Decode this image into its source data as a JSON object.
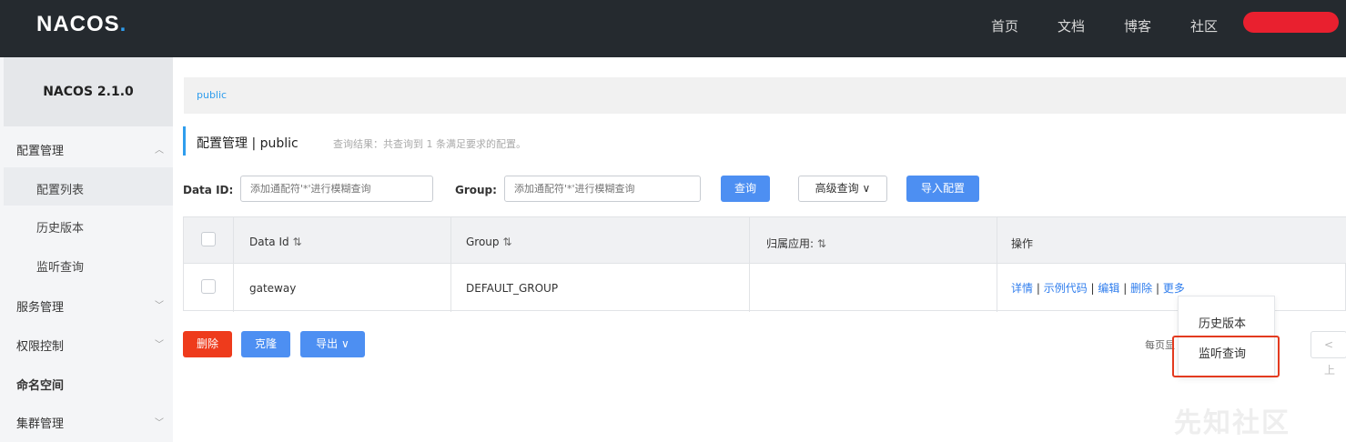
{
  "header": {
    "logo_main": "NACOS",
    "logo_dot": ".",
    "nav": [
      "首页",
      "文档",
      "博客",
      "社区"
    ]
  },
  "sidebar": {
    "version": "NACOS 2.1.0",
    "items": [
      {
        "label": "配置管理",
        "expanded": true
      },
      {
        "label": "配置列表"
      },
      {
        "label": "历史版本"
      },
      {
        "label": "监听查询"
      },
      {
        "label": "服务管理"
      },
      {
        "label": "权限控制"
      },
      {
        "label": "命名空间"
      },
      {
        "label": "集群管理"
      }
    ]
  },
  "breadcrumb": "public",
  "page": {
    "title": "配置管理 | public",
    "result_info": "查询结果：共查询到 1 条满足要求的配置。"
  },
  "search": {
    "dataid_label": "Data ID:",
    "dataid_placeholder": "添加通配符'*'进行模糊查询",
    "group_label": "Group:",
    "group_placeholder": "添加通配符'*'进行模糊查询",
    "query_button": "查询",
    "advanced_button": "高级查询",
    "import_button": "导入配置"
  },
  "table": {
    "headers": [
      "Data Id",
      "Group",
      "归属应用:",
      "操作"
    ],
    "rows": [
      {
        "data_id": "gateway",
        "group": "DEFAULT_GROUP",
        "app": "",
        "actions": [
          "详情",
          "示例代码",
          "编辑",
          "删除",
          "更多"
        ]
      }
    ]
  },
  "bulk": {
    "delete": "删除",
    "clone": "克隆",
    "export": "导出"
  },
  "more_menu": [
    "历史版本",
    "监听查询"
  ],
  "pager": {
    "per_page_text": "每页显",
    "prev": "< 上"
  },
  "watermark": "先知社区",
  "colors": {
    "topbar": "#252a2f",
    "primary": "#4d8ff2",
    "danger": "#ee3b1c",
    "highlight": "#e33a1f"
  }
}
